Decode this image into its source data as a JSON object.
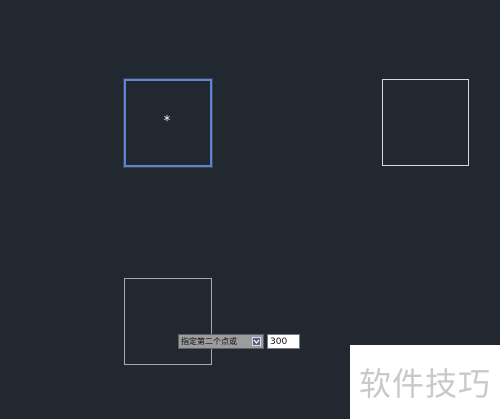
{
  "canvas": {
    "background": "#212830",
    "selection_color": "#5d86d0",
    "line_color": "#d9d9d9"
  },
  "base_point": {
    "glyph": "*"
  },
  "command_prompt": {
    "prompt_text": "指定第二个点或",
    "options_icon": "chevron-down-icon",
    "input_value": "300"
  },
  "watermark": {
    "text": "软件技巧"
  }
}
